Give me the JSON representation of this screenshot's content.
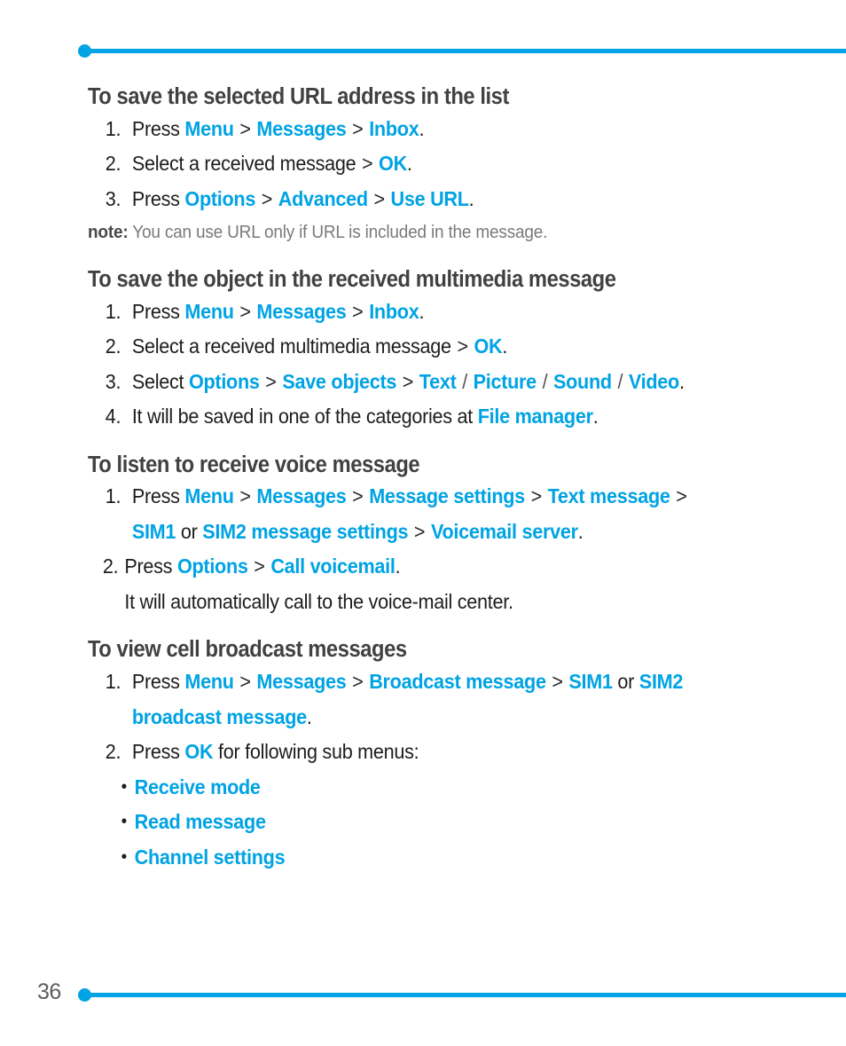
{
  "page": {
    "number": "36",
    "accent_color": "#00a3e4",
    "heading_color": "#414141",
    "body_color": "#1d1d1d",
    "note_color": "#7a7a7a"
  },
  "sections": [
    {
      "heading": "To save the selected URL address in the list",
      "steps": [
        {
          "num": "1.",
          "parts": [
            {
              "t": "Press ",
              "s": "plain"
            },
            {
              "t": "Menu",
              "s": "b"
            },
            {
              "t": " > ",
              "s": "gt"
            },
            {
              "t": "Messages",
              "s": "b"
            },
            {
              "t": " > ",
              "s": "gt"
            },
            {
              "t": "Inbox",
              "s": "b"
            },
            {
              "t": ".",
              "s": "plain"
            }
          ]
        },
        {
          "num": "2.",
          "parts": [
            {
              "t": "Select a received message ",
              "s": "plain"
            },
            {
              "t": "> ",
              "s": "gt"
            },
            {
              "t": "OK",
              "s": "b"
            },
            {
              "t": ".",
              "s": "plain"
            }
          ]
        },
        {
          "num": "3.",
          "parts": [
            {
              "t": "Press ",
              "s": "plain"
            },
            {
              "t": "Options",
              "s": "b"
            },
            {
              "t": " > ",
              "s": "gt"
            },
            {
              "t": "Advanced",
              "s": "b"
            },
            {
              "t": " > ",
              "s": "gt"
            },
            {
              "t": "Use URL",
              "s": "b"
            },
            {
              "t": ".",
              "s": "plain"
            }
          ]
        }
      ],
      "note": {
        "label": "note:",
        "text": " You can use URL only if URL is included in the message."
      }
    },
    {
      "heading": "To save the object in the received multimedia message",
      "steps": [
        {
          "num": "1.",
          "parts": [
            {
              "t": "Press ",
              "s": "plain"
            },
            {
              "t": "Menu",
              "s": "b"
            },
            {
              "t": " > ",
              "s": "gt"
            },
            {
              "t": "Messages",
              "s": "b"
            },
            {
              "t": " > ",
              "s": "gt"
            },
            {
              "t": "Inbox",
              "s": "b"
            },
            {
              "t": ".",
              "s": "plain"
            }
          ]
        },
        {
          "num": "2.",
          "parts": [
            {
              "t": "Select a received multimedia message ",
              "s": "plain"
            },
            {
              "t": "> ",
              "s": "gt"
            },
            {
              "t": "OK",
              "s": "b"
            },
            {
              "t": ".",
              "s": "plain"
            }
          ]
        },
        {
          "num": "3.",
          "parts": [
            {
              "t": "Select ",
              "s": "plain"
            },
            {
              "t": "Options",
              "s": "b"
            },
            {
              "t": " > ",
              "s": "gt"
            },
            {
              "t": "Save objects",
              "s": "b"
            },
            {
              "t": " > ",
              "s": "gt"
            },
            {
              "t": "Text",
              "s": "b"
            },
            {
              "t": " / ",
              "s": "sl"
            },
            {
              "t": "Picture",
              "s": "b"
            },
            {
              "t": " / ",
              "s": "sl"
            },
            {
              "t": "Sound",
              "s": "b"
            },
            {
              "t": " / ",
              "s": "sl"
            },
            {
              "t": "Video",
              "s": "b"
            },
            {
              "t": ".",
              "s": "plain"
            }
          ]
        },
        {
          "num": "4.",
          "parts": [
            {
              "t": "It will be saved in one of the categories at ",
              "s": "plain"
            },
            {
              "t": "File manager",
              "s": "b"
            },
            {
              "t": ".",
              "s": "plain"
            }
          ]
        }
      ]
    },
    {
      "heading": "To listen to receive voice message",
      "steps": [
        {
          "num": "1.",
          "parts": [
            {
              "t": "Press ",
              "s": "plain"
            },
            {
              "t": "Menu",
              "s": "b"
            },
            {
              "t": " > ",
              "s": "gt"
            },
            {
              "t": "Messages",
              "s": "b"
            },
            {
              "t": " > ",
              "s": "gt"
            },
            {
              "t": "Message settings",
              "s": "b"
            },
            {
              "t": " > ",
              "s": "gt"
            },
            {
              "t": "Text message",
              "s": "b"
            },
            {
              "t": " >",
              "s": "gt"
            },
            {
              "t": "\n",
              "s": "break"
            },
            {
              "t": "SIM1",
              "s": "b"
            },
            {
              "t": " or ",
              "s": "plain"
            },
            {
              "t": "SIM2 message settings",
              "s": "b"
            },
            {
              "t": " > ",
              "s": "gt"
            },
            {
              "t": "Voicemail server",
              "s": "b"
            },
            {
              "t": ".",
              "s": "plain"
            }
          ]
        },
        {
          "num": "2.",
          "tight": true,
          "parts": [
            {
              "t": "Press ",
              "s": "plain"
            },
            {
              "t": "Options",
              "s": "b"
            },
            {
              "t": " > ",
              "s": "gt"
            },
            {
              "t": "Call voicemail",
              "s": "b"
            },
            {
              "t": ".",
              "s": "plain"
            },
            {
              "t": "\n",
              "s": "break"
            },
            {
              "t": "It will automatically call to the voice-mail center.",
              "s": "plain"
            }
          ]
        }
      ]
    },
    {
      "heading": "To view cell broadcast messages",
      "steps": [
        {
          "num": "1.",
          "parts": [
            {
              "t": "Press ",
              "s": "plain"
            },
            {
              "t": "Menu",
              "s": "b"
            },
            {
              "t": " > ",
              "s": "gt"
            },
            {
              "t": "Messages",
              "s": "b"
            },
            {
              "t": " > ",
              "s": "gt"
            },
            {
              "t": "Broadcast message",
              "s": "b"
            },
            {
              "t": " > ",
              "s": "gt"
            },
            {
              "t": "SIM1",
              "s": "b"
            },
            {
              "t": " or ",
              "s": "plain"
            },
            {
              "t": "SIM2",
              "s": "b"
            },
            {
              "t": "\n",
              "s": "break"
            },
            {
              "t": "broadcast message",
              "s": "b"
            },
            {
              "t": ".",
              "s": "plain"
            }
          ]
        },
        {
          "num": "2.",
          "parts": [
            {
              "t": "Press ",
              "s": "plain"
            },
            {
              "t": "OK",
              "s": "b"
            },
            {
              "t": " for following sub menus:",
              "s": "plain"
            }
          ]
        }
      ],
      "bullets": [
        {
          "marker": "•",
          "label": "Receive mode"
        },
        {
          "marker": "•",
          "label": "Read message"
        },
        {
          "marker": "•",
          "label": "Channel settings"
        }
      ]
    }
  ]
}
